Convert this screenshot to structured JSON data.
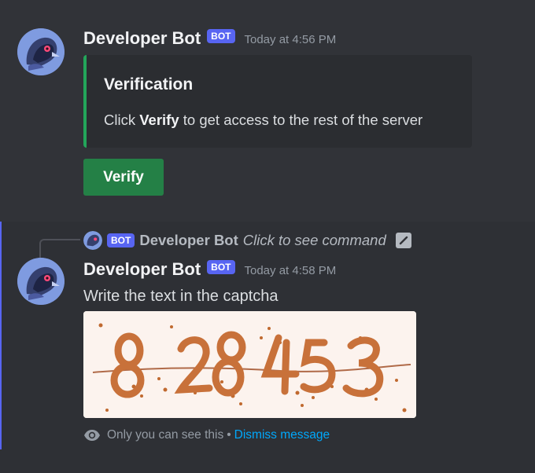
{
  "messages": [
    {
      "author": "Developer Bot",
      "bot_tag": "BOT",
      "timestamp": "Today at 4:56 PM",
      "embed": {
        "title": "Verification",
        "desc_prefix": "Click",
        "desc_bold": "Verify",
        "desc_suffix": "to get access to the rest of the server",
        "accent_color": "#23a55a"
      },
      "button_label": "Verify"
    },
    {
      "reply": {
        "bot_tag": "BOT",
        "author": "Developer Bot",
        "command_text": "Click to see command"
      },
      "author": "Developer Bot",
      "bot_tag": "BOT",
      "timestamp": "Today at 4:58 PM",
      "text": "Write the text in the captcha",
      "captcha_text": "828453",
      "ephemeral": {
        "notice": "Only you can see this",
        "separator": "•",
        "dismiss_label": "Dismiss message"
      }
    }
  ],
  "colors": {
    "background": "#313338",
    "bot_tag": "#5865f2",
    "button_green": "#248046",
    "link": "#00a8fc"
  },
  "icons": [
    "bot-avatar",
    "command-icon",
    "eye-icon"
  ]
}
